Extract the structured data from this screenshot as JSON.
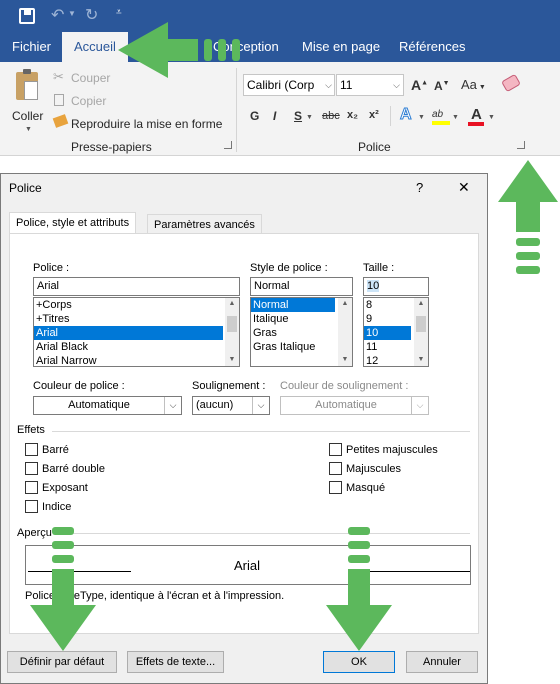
{
  "ribbon": {
    "tabs": [
      "Fichier",
      "Accueil",
      "Conception",
      "Mise en page",
      "Références"
    ],
    "active_tab": "Accueil",
    "clipboard": {
      "paste_label": "Coller",
      "cut_label": "Couper",
      "copy_label": "Copier",
      "format_painter_label": "Reproduire la mise en forme",
      "group_label": "Presse-papiers"
    },
    "font": {
      "font_name": "Calibri (Corp",
      "font_size": "11",
      "group_label": "Police",
      "grow_label": "A",
      "shrink_label": "A",
      "case_label": "Aa",
      "bold": "G",
      "italic": "I",
      "underline": "S",
      "strike": "abc",
      "subscript": "x₂",
      "superscript": "x²",
      "text_effects": "A",
      "highlight": "ab",
      "font_color": "A"
    },
    "colors": {
      "accent": "#2b579a",
      "font_color_bar": "#e81123",
      "highlight_bar": "#ffff00"
    }
  },
  "dialog": {
    "title": "Police",
    "help": "?",
    "close": "✕",
    "tabs": [
      "Police, style et attributs",
      "Paramètres avancés"
    ],
    "font_label": "Police :",
    "font_value": "Arial",
    "font_list": [
      "+Corps",
      "+Titres",
      "Arial",
      "Arial Black",
      "Arial Narrow"
    ],
    "font_selected": "Arial",
    "style_label": "Style de police :",
    "style_value": "Normal",
    "style_list": [
      "Normal",
      "Italique",
      "Gras",
      "Gras Italique"
    ],
    "style_selected": "Normal",
    "size_label": "Taille :",
    "size_value": "10",
    "size_list": [
      "8",
      "9",
      "10",
      "11",
      "12"
    ],
    "size_selected": "10",
    "font_color_label": "Couleur de police :",
    "font_color_value": "Automatique",
    "underline_label": "Soulignement :",
    "underline_value": "(aucun)",
    "underline_color_label": "Couleur de soulignement :",
    "underline_color_value": "Automatique",
    "effects_label": "Effets",
    "effects_left": [
      "Barré",
      "Barré double",
      "Exposant",
      "Indice"
    ],
    "effects_right": [
      "Petites majuscules",
      "Majuscules",
      "Masqué"
    ],
    "preview_label": "Aperçu",
    "preview_text": "Arial",
    "description": "Police TrueType, identique à l'écran et à l'impression.",
    "set_default_label": "Définir par défaut",
    "text_effects_label": "Effets de texte...",
    "ok_label": "OK",
    "cancel_label": "Annuler"
  }
}
